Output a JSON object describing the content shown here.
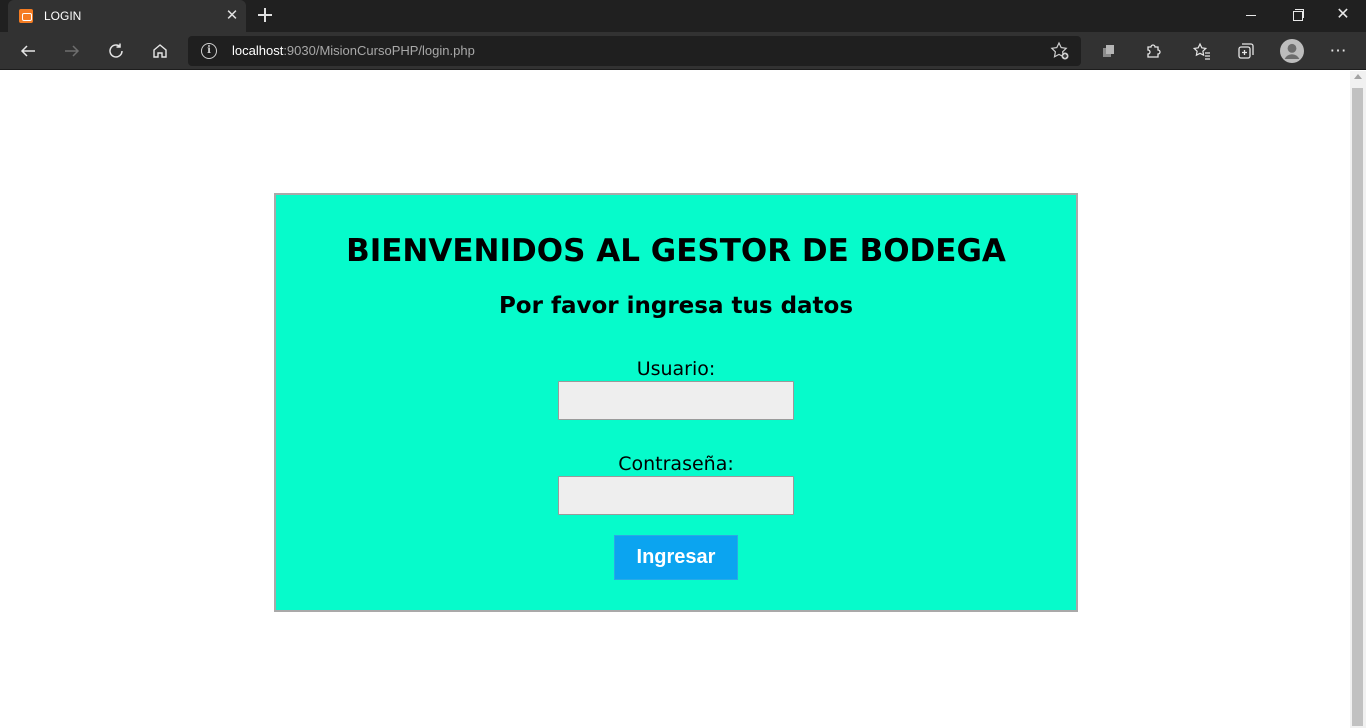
{
  "browser": {
    "tab_title": "LOGIN",
    "url_host": "localhost",
    "url_rest": ":9030/MisionCursoPHP/login.php"
  },
  "page": {
    "title": "BIENVENIDOS AL GESTOR DE BODEGA",
    "subtitle": "Por favor ingresa tus datos",
    "user_label": "Usuario:",
    "user_value": "",
    "password_label": "Contraseña:",
    "password_value": "",
    "submit_label": "Ingresar"
  },
  "colors": {
    "card_background": "#06fbcb",
    "button_background": "#0ba4f0"
  },
  "icons": [
    "xampp-favicon-icon",
    "close-tab-icon",
    "new-tab-icon",
    "back-icon",
    "forward-icon",
    "refresh-icon",
    "home-icon",
    "info-icon",
    "add-favorite-icon",
    "collections-icon",
    "extensions-icon",
    "favorites-icon",
    "tab-actions-icon",
    "profile-icon",
    "more-icon"
  ]
}
